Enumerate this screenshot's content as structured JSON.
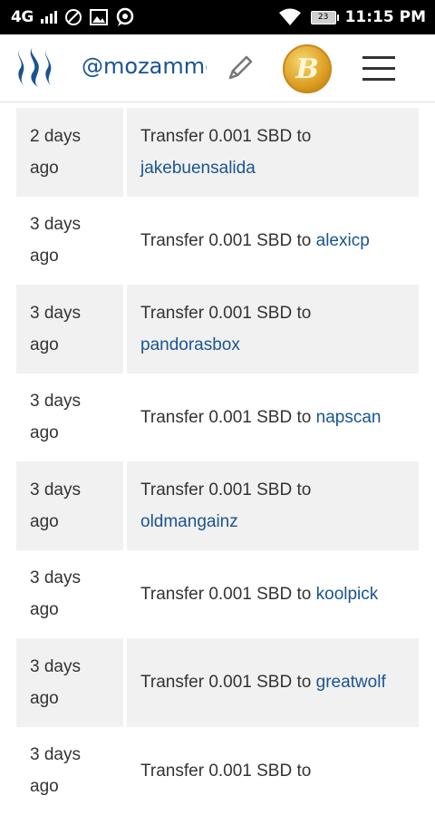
{
  "status_bar": {
    "network": "4G",
    "battery": "23",
    "time": "11:15 PM"
  },
  "header": {
    "username": "@mozammel",
    "logo_icon": "steem-logo-icon",
    "edit_icon": "edit-pencil-icon",
    "coin_label": "B",
    "menu_icon": "hamburger-menu-icon"
  },
  "colors": {
    "link": "#1a5490",
    "shaded_row": "#f1f1f1",
    "status_bar": "#000000"
  },
  "transfers": [
    {
      "date_line1": "2 days",
      "date_line2": "ago",
      "text": "Transfer 0.001 SBD to",
      "recipient": "jakebuensalida"
    },
    {
      "date_line1": "3 days",
      "date_line2": "ago",
      "text": "Transfer 0.001 SBD to",
      "recipient": "alexicp"
    },
    {
      "date_line1": "3 days",
      "date_line2": "ago",
      "text": "Transfer 0.001 SBD to",
      "recipient": "pandorasbox"
    },
    {
      "date_line1": "3 days",
      "date_line2": "ago",
      "text": "Transfer 0.001 SBD to",
      "recipient": "napscan"
    },
    {
      "date_line1": "3 days",
      "date_line2": "ago",
      "text": "Transfer 0.001 SBD to",
      "recipient": "oldmangainz"
    },
    {
      "date_line1": "3 days",
      "date_line2": "ago",
      "text": "Transfer 0.001 SBD to",
      "recipient": "koolpick"
    },
    {
      "date_line1": "3 days",
      "date_line2": "ago",
      "text": "Transfer 0.001 SBD to",
      "recipient": "greatwolf"
    },
    {
      "date_line1": "3 days",
      "date_line2": "ago",
      "text": "Transfer 0.001 SBD to",
      "recipient": ""
    }
  ]
}
